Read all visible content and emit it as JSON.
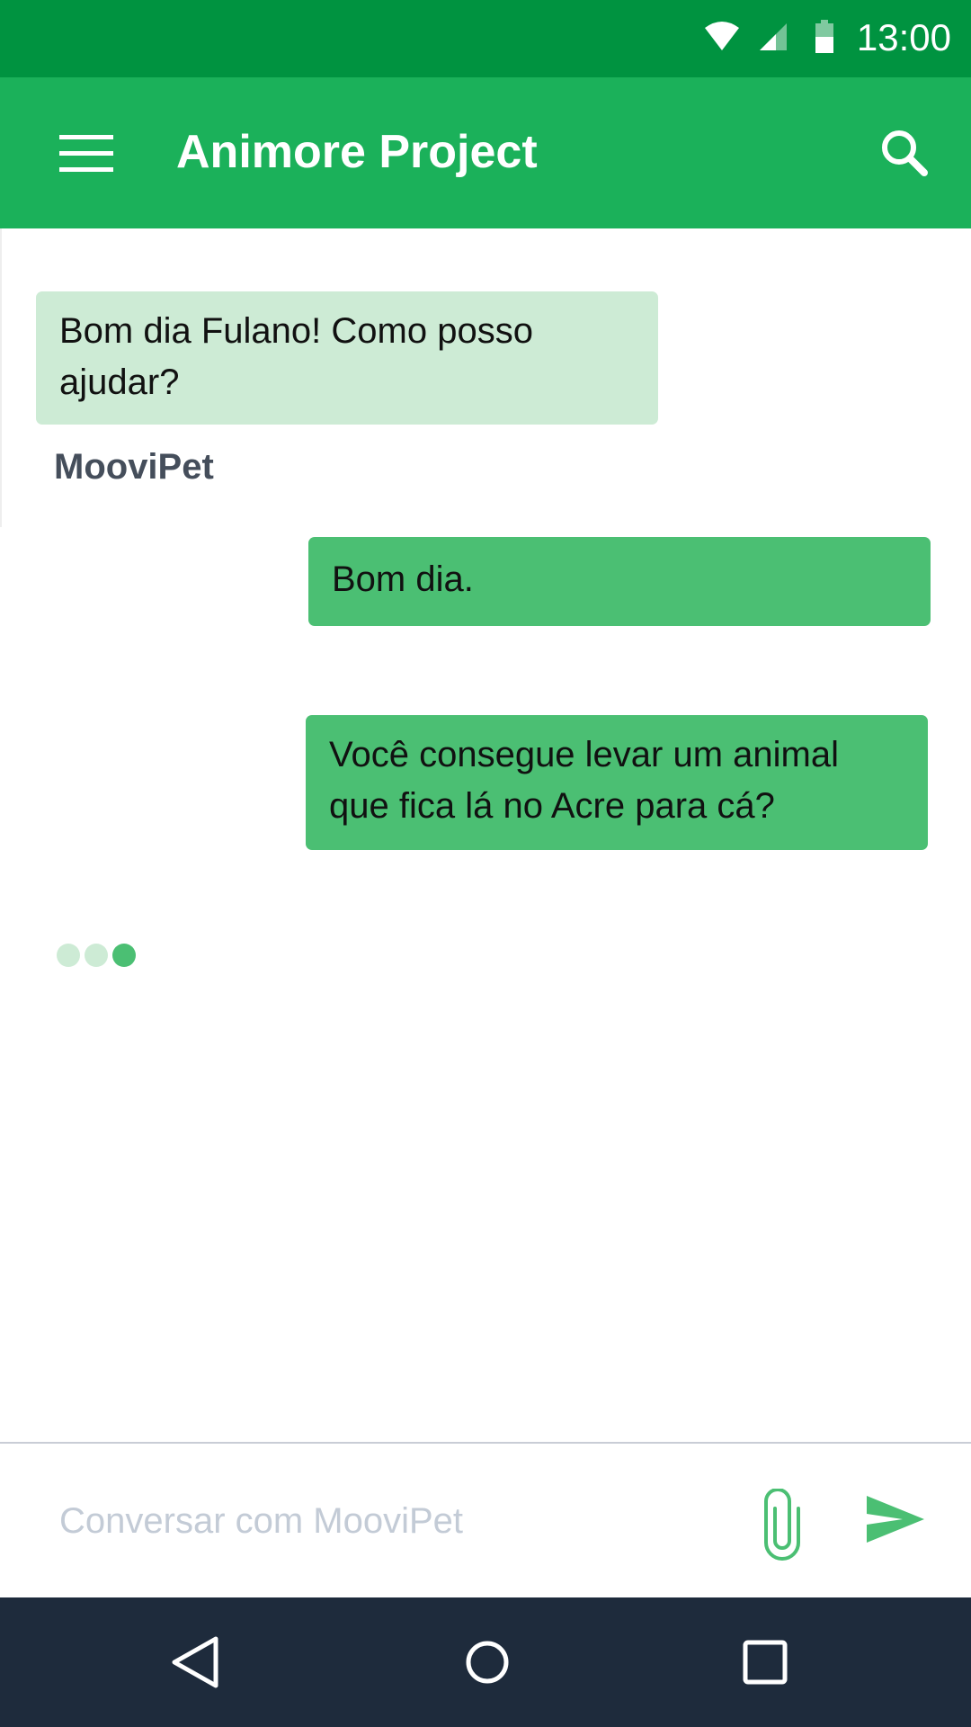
{
  "status_bar": {
    "time": "13:00",
    "icons": [
      "wifi-icon",
      "cell-signal-icon",
      "battery-icon"
    ]
  },
  "app_bar": {
    "title": "Animore Project",
    "icons": [
      "menu-icon",
      "search-icon"
    ]
  },
  "chat": {
    "messages": [
      {
        "from": "bot",
        "text": "Bom dia Fulano! Como posso ajudar?"
      },
      {
        "from": "user",
        "text": "Bom dia."
      },
      {
        "from": "user",
        "text": "Você consegue levar um animal que fica lá no Acre para cá?"
      }
    ],
    "bot_name": "MooviPet",
    "typing_indicator": true
  },
  "composer": {
    "placeholder": "Conversar com MooviPet",
    "value": "",
    "icons": [
      "paperclip-icon",
      "send-icon"
    ]
  },
  "nav_bar": {
    "icons": [
      "back-icon",
      "home-icon",
      "recents-icon"
    ]
  },
  "colors": {
    "status_bar": "#009340",
    "app_bar": "#1bb15a",
    "bot_bubble": "#cdebd5",
    "user_bubble": "#4bbf73",
    "accent": "#4bbf73",
    "nav_bar": "#1e2b3c"
  }
}
